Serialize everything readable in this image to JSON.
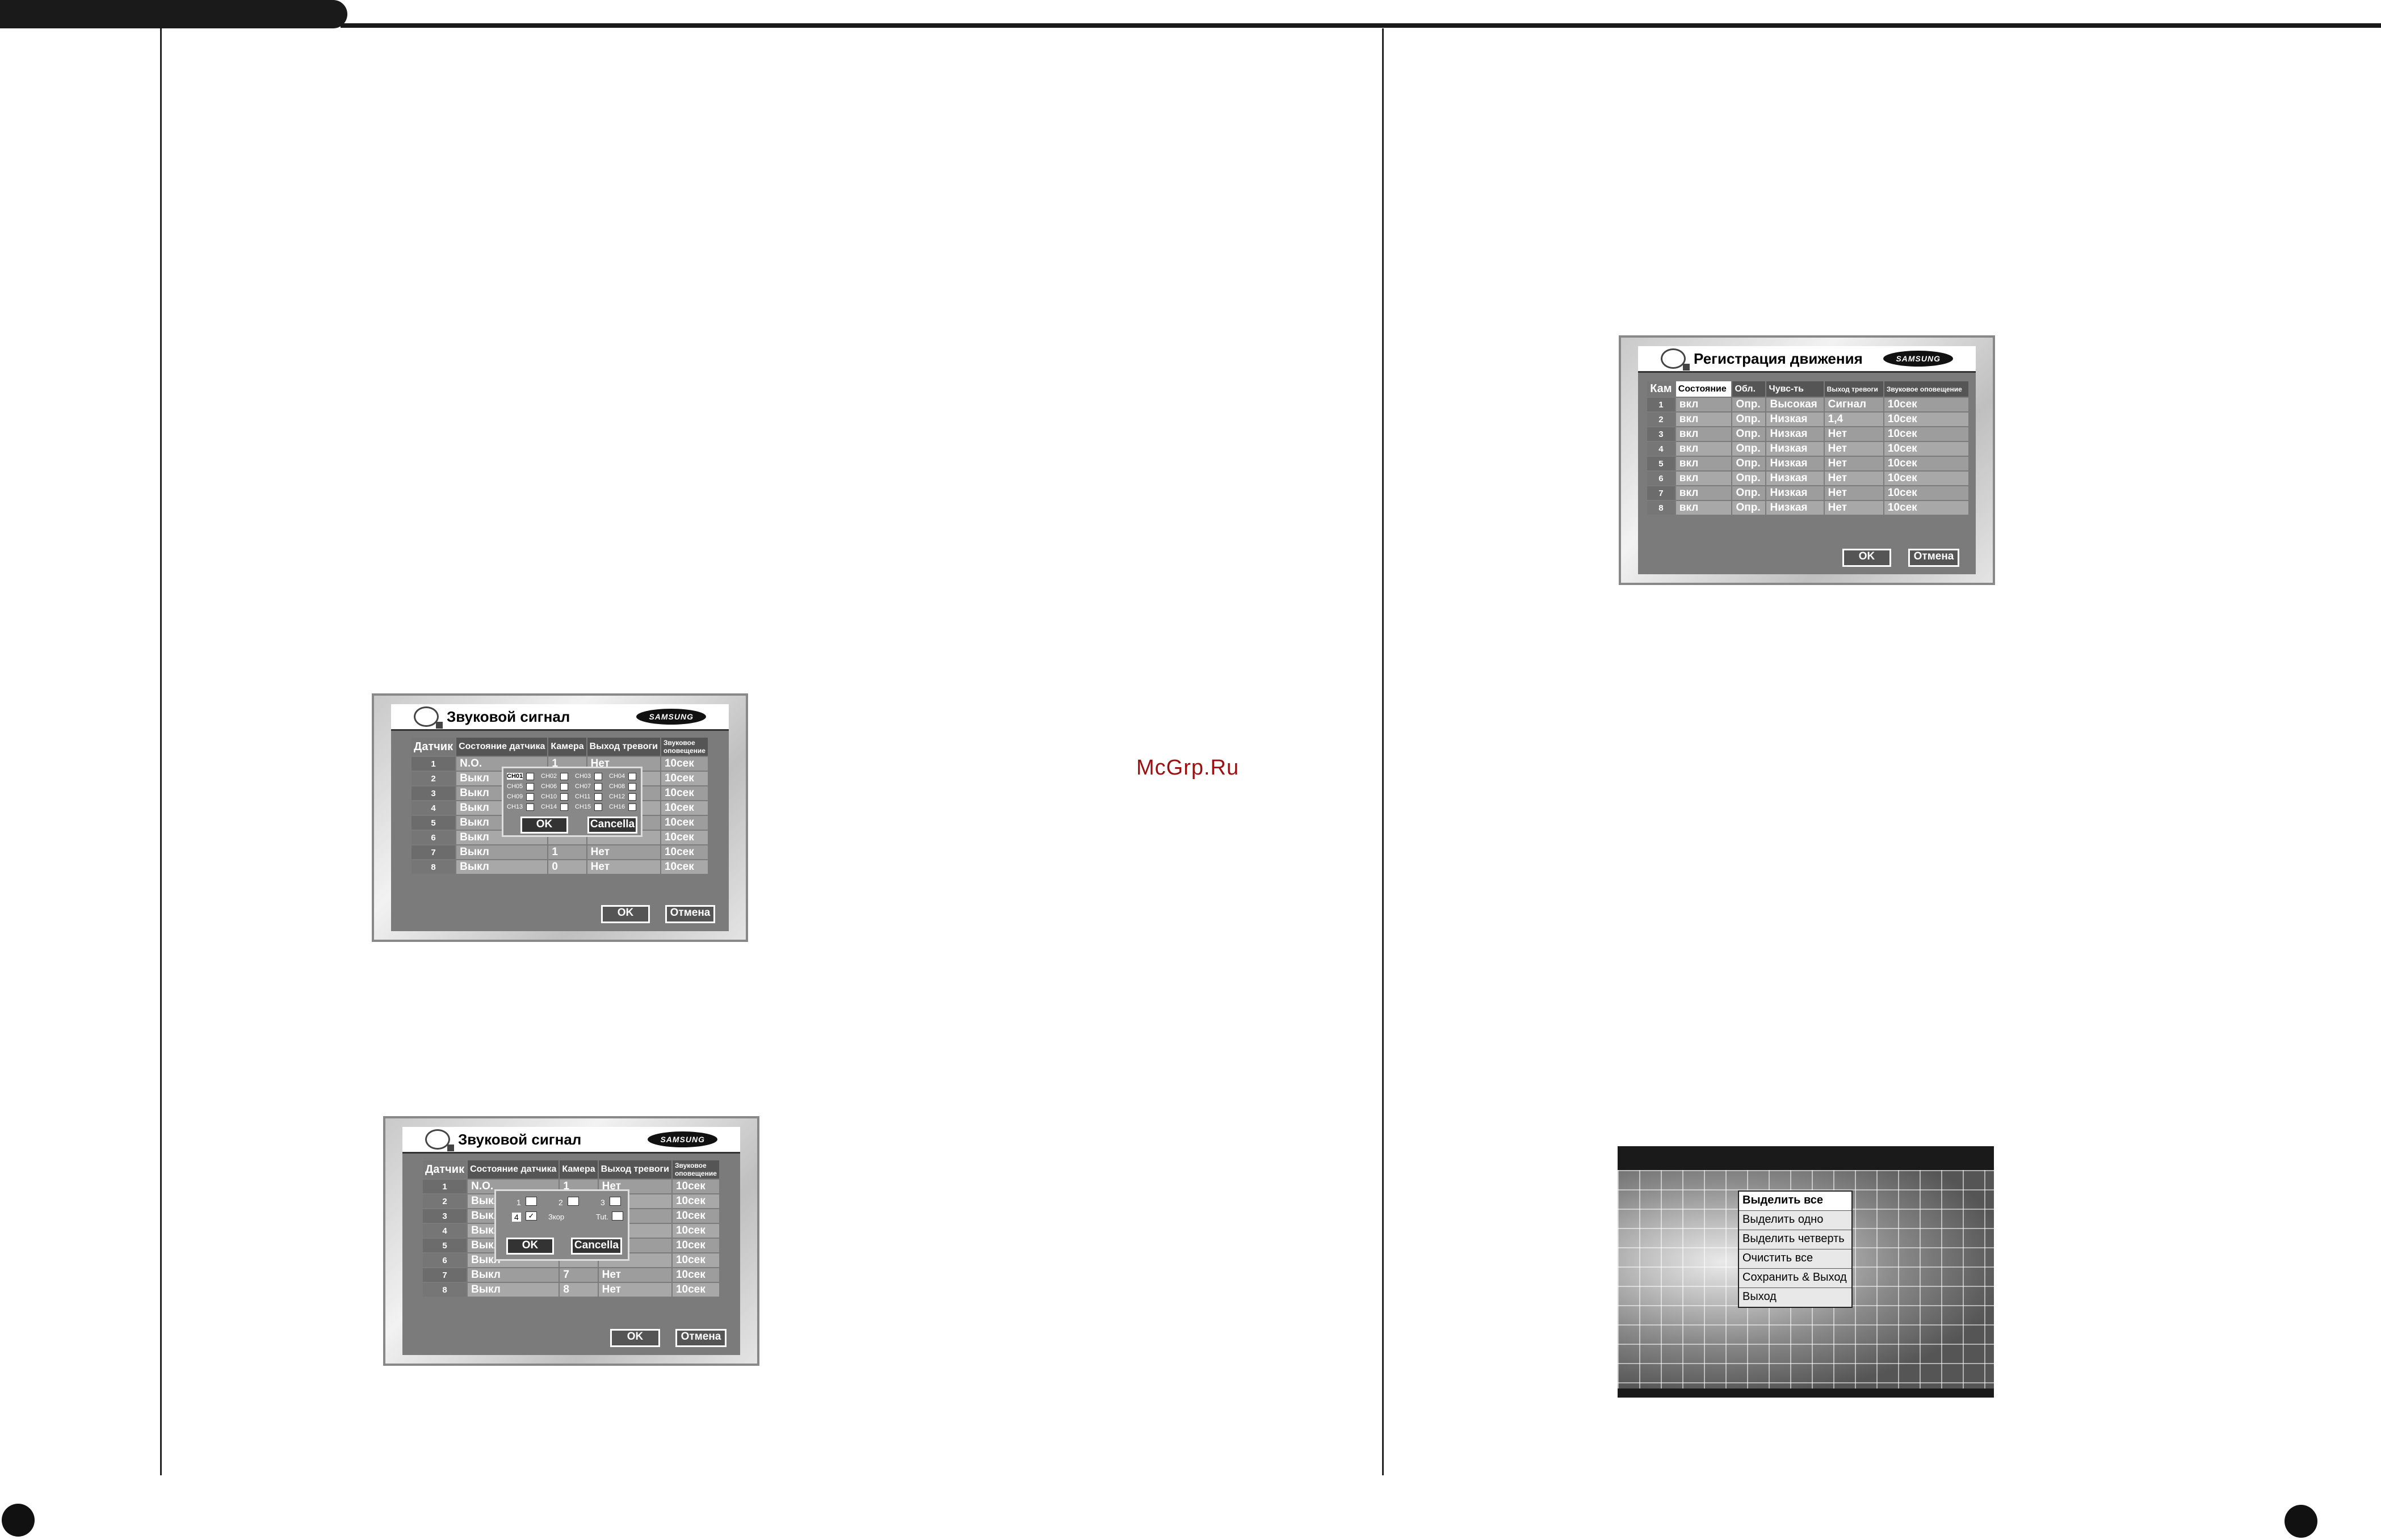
{
  "watermark": "McGrp.Ru",
  "sound_signal_1": {
    "title": "Звуковой сигнал",
    "logo": "SAMSUNG",
    "headers": [
      "Датчик",
      "Состояние датчика",
      "Камера",
      "Выход тревоги",
      "Звуковое оповещение"
    ],
    "rows": [
      [
        "1",
        "N.O.",
        "1",
        "Нет",
        "10сек"
      ],
      [
        "2",
        "Выкл",
        "",
        "",
        "10сек"
      ],
      [
        "3",
        "Выкл",
        "",
        "",
        "10сек"
      ],
      [
        "4",
        "Выкл",
        "",
        "",
        "10сек"
      ],
      [
        "5",
        "Выкл",
        "",
        "",
        "10сек"
      ],
      [
        "6",
        "Выкл",
        "",
        "",
        "10сек"
      ],
      [
        "7",
        "Выкл",
        "1",
        "Нет",
        "10сек"
      ],
      [
        "8",
        "Выкл",
        "0",
        "Нет",
        "10сек"
      ]
    ],
    "popup": {
      "channels": [
        "CH01",
        "CH02",
        "CH03",
        "CH04",
        "CH05",
        "CH06",
        "CH07",
        "CH08",
        "CH09",
        "CH10",
        "CH11",
        "CH12",
        "CH13",
        "CH14",
        "CH15",
        "CH16"
      ],
      "ok": "OK",
      "cancel": "Cancella"
    },
    "ok": "OK",
    "cancel": "Отмена"
  },
  "sound_signal_2": {
    "title": "Звуковой сигнал",
    "logo": "SAMSUNG",
    "headers": [
      "Датчик",
      "Состояние датчика",
      "Камера",
      "Выход тревоги",
      "Звуковое оповещение"
    ],
    "rows": [
      [
        "1",
        "N.O.",
        "1",
        "Нет",
        "10сек"
      ],
      [
        "2",
        "Выкл",
        "",
        "",
        "10сек"
      ],
      [
        "3",
        "Выкл",
        "",
        "",
        "10сек"
      ],
      [
        "4",
        "Выкл",
        "",
        "",
        "10сек"
      ],
      [
        "5",
        "Выкл",
        "",
        "",
        "10сек"
      ],
      [
        "6",
        "Выкл",
        "",
        "",
        "10сек"
      ],
      [
        "7",
        "Выкл",
        "7",
        "Нет",
        "10сек"
      ],
      [
        "8",
        "Выкл",
        "8",
        "Нет",
        "10сек"
      ]
    ],
    "popup": {
      "labels": [
        "1",
        "2",
        "3",
        "4",
        "Зкор",
        "Tut."
      ],
      "ok": "OK",
      "cancel": "Cancella"
    },
    "ok": "OK",
    "cancel": "Отмена"
  },
  "motion": {
    "title": "Регистрация движения",
    "logo": "SAMSUNG",
    "headers": [
      "Кам",
      "Состояние",
      "Обл.",
      "Чувс-ть",
      "Выход тревоги",
      "Звуковое оповещение"
    ],
    "rows": [
      [
        "1",
        "вкл",
        "Опр.",
        "Высокая",
        "Сигнал",
        "10сек"
      ],
      [
        "2",
        "вкл",
        "Опр.",
        "Низкая",
        "1,4",
        "10сек"
      ],
      [
        "3",
        "вкл",
        "Опр.",
        "Низкая",
        "Нет",
        "10сек"
      ],
      [
        "4",
        "вкл",
        "Опр.",
        "Низкая",
        "Нет",
        "10сек"
      ],
      [
        "5",
        "вкл",
        "Опр.",
        "Низкая",
        "Нет",
        "10сек"
      ],
      [
        "6",
        "вкл",
        "Опр.",
        "Низкая",
        "Нет",
        "10сек"
      ],
      [
        "7",
        "вкл",
        "Опр.",
        "Низкая",
        "Нет",
        "10сек"
      ],
      [
        "8",
        "вкл",
        "Опр.",
        "Низкая",
        "Нет",
        "10сек"
      ]
    ],
    "ok": "OK",
    "cancel": "Отмена"
  },
  "area_menu": {
    "items": [
      "Выделить все",
      "Выделить одно",
      "Выделить четверть",
      "Очистить все",
      "Сохранить & Выход",
      "Выход"
    ]
  }
}
